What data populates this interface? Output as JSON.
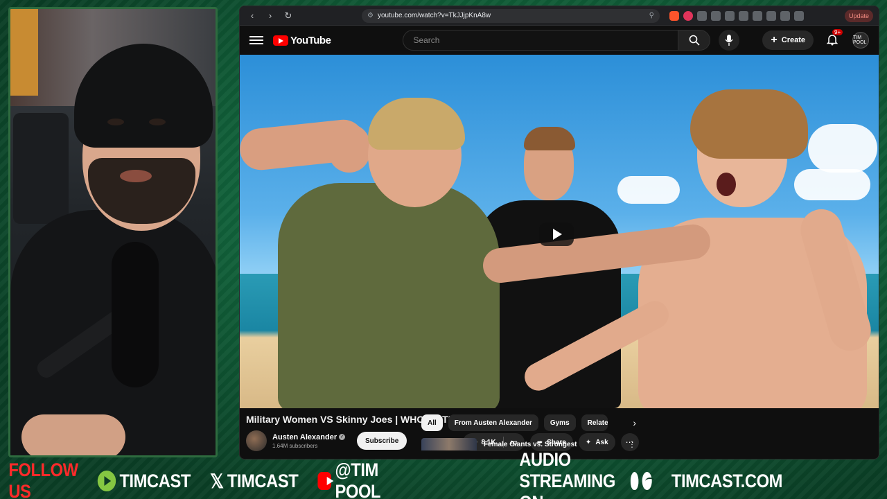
{
  "browser": {
    "url": "youtube.com/watch?v=TkJJjpKnA8w",
    "update_label": "Update"
  },
  "youtube": {
    "logo_text": "YouTube",
    "search_placeholder": "Search",
    "create_label": "Create",
    "notif_badge": "9+",
    "avatar_text": "TIM POOL"
  },
  "video": {
    "title": "Military Women VS Skinny Joes | WHO'S STRONGER?!",
    "channel": "Austen Alexander",
    "subscribers": "1.64M subscribers",
    "subscribe_label": "Subscribe",
    "likes": "8.1K",
    "share_label": "Share",
    "ask_label": "Ask"
  },
  "sidebar": {
    "chips": [
      "All",
      "From Austen Alexander",
      "Gyms",
      "Relate"
    ],
    "rec_title": "Female Giants vs. Strongest"
  },
  "ticker": {
    "follow": "FOLLOW US",
    "rumble": "TIMCAST",
    "x": "TIMCAST",
    "youtube": "@TIM POOL",
    "audio": "AUDIO STREAMING ON",
    "site": "TIMCAST.COM"
  },
  "colors": {
    "frame_green": "#11613a",
    "follow_red": "#ff2a2a",
    "yt_red": "#ff0000",
    "rumble_green": "#85c742"
  }
}
